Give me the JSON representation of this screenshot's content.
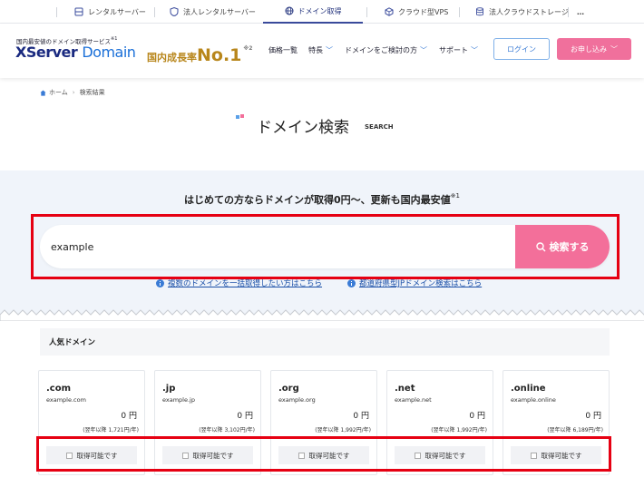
{
  "service_bar": {
    "items": [
      {
        "label": "レンタルサーバー",
        "active": false
      },
      {
        "label": "法人レンタルサーバー",
        "active": false
      },
      {
        "label": "ドメイン取得",
        "active": true
      },
      {
        "label": "クラウド型VPS",
        "active": false
      },
      {
        "label": "法人クラウドストレージ",
        "active": false
      }
    ],
    "more": "…"
  },
  "header": {
    "tagline": "国内最安値のドメイン取得サービス",
    "tagline_note": "※1",
    "logo_main": "XServer",
    "logo_domain": "Domain",
    "rank_label": "国内成長率",
    "rank_value": "No.1",
    "rank_note": "※2",
    "nav": [
      {
        "label": "価格一覧",
        "dropdown": false
      },
      {
        "label": "特長",
        "dropdown": true
      },
      {
        "label": "ドメインをご検討の方",
        "dropdown": true
      },
      {
        "label": "サポート",
        "dropdown": true
      }
    ],
    "login_label": "ログイン",
    "apply_label": "お申し込み"
  },
  "breadcrumb": {
    "home": "ホーム",
    "current": "検索結果"
  },
  "page": {
    "title": "ドメイン検索",
    "subtitle": "SEARCH"
  },
  "search": {
    "lead": "はじめての方ならドメインが取得0円〜、更新も国内最安値",
    "lead_note": "※1",
    "value": "example",
    "button_label": "検索する",
    "links": [
      "複数のドメインを一括取得したい方はこちら",
      "都道府県型JPドメイン検索はこちら"
    ]
  },
  "popular": {
    "heading": "人気ドメイン",
    "domains": [
      {
        "tld": ".com",
        "example": "example.com",
        "price": "0 円",
        "renewal": "(翌年以降 1,721円/年)",
        "status": "取得可能です"
      },
      {
        "tld": ".jp",
        "example": "example.jp",
        "price": "0 円",
        "renewal": "(翌年以降 3,102円/年)",
        "status": "取得可能です"
      },
      {
        "tld": ".org",
        "example": "example.org",
        "price": "0 円",
        "renewal": "(翌年以降 1,992円/年)",
        "status": "取得可能です"
      },
      {
        "tld": ".net",
        "example": "example.net",
        "price": "0 円",
        "renewal": "(翌年以降 1,992円/年)",
        "status": "取得可能です"
      },
      {
        "tld": ".online",
        "example": "example.online",
        "price": "0 円",
        "renewal": "(翌年以降 6,189円/年)",
        "status": "取得可能です"
      }
    ]
  },
  "colors": {
    "accent_pink": "#f36f9a",
    "brand_navy": "#1a2a80",
    "highlight_red": "#e60012",
    "link_blue": "#1a4fa8"
  }
}
